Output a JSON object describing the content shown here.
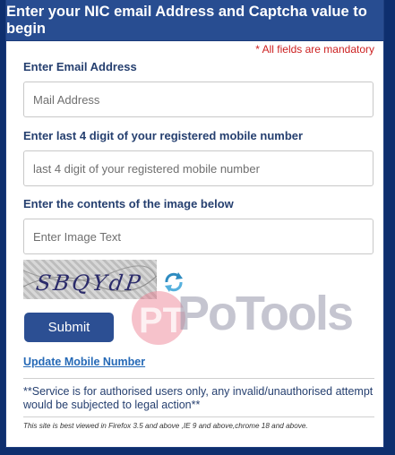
{
  "header": {
    "title": "Enter your NIC email Address and Captcha value to begin"
  },
  "mandatory_note": "* All fields are mandatory",
  "form": {
    "email_label": "Enter Email Address",
    "email_placeholder": "Mail Address",
    "mobile_label": "Enter last 4 digit of your registered mobile number",
    "mobile_placeholder": "last 4 digit of your registered mobile number",
    "captcha_label": "Enter the contents of the image below",
    "captcha_placeholder": "Enter Image Text",
    "captcha_text": "SBQYdP",
    "refresh_icon": "refresh-icon",
    "submit_label": "Submit",
    "update_link": "Update Mobile Number"
  },
  "watermark": {
    "text": "PoTools",
    "badge": "PT"
  },
  "notice": "**Service is for authorised users only, any invalid/unauthorised attempt would be subjected to legal action**",
  "browser_note": "This site is best viewed in Firefox 3.5 and above ,IE 9 and above,chrome 18 and above.",
  "colors": {
    "header_bg": "#284d91",
    "page_bg": "#0e2f6e",
    "mandatory": "#cc1f1f",
    "link": "#2569b6",
    "submit_bg": "#2c4f93"
  }
}
